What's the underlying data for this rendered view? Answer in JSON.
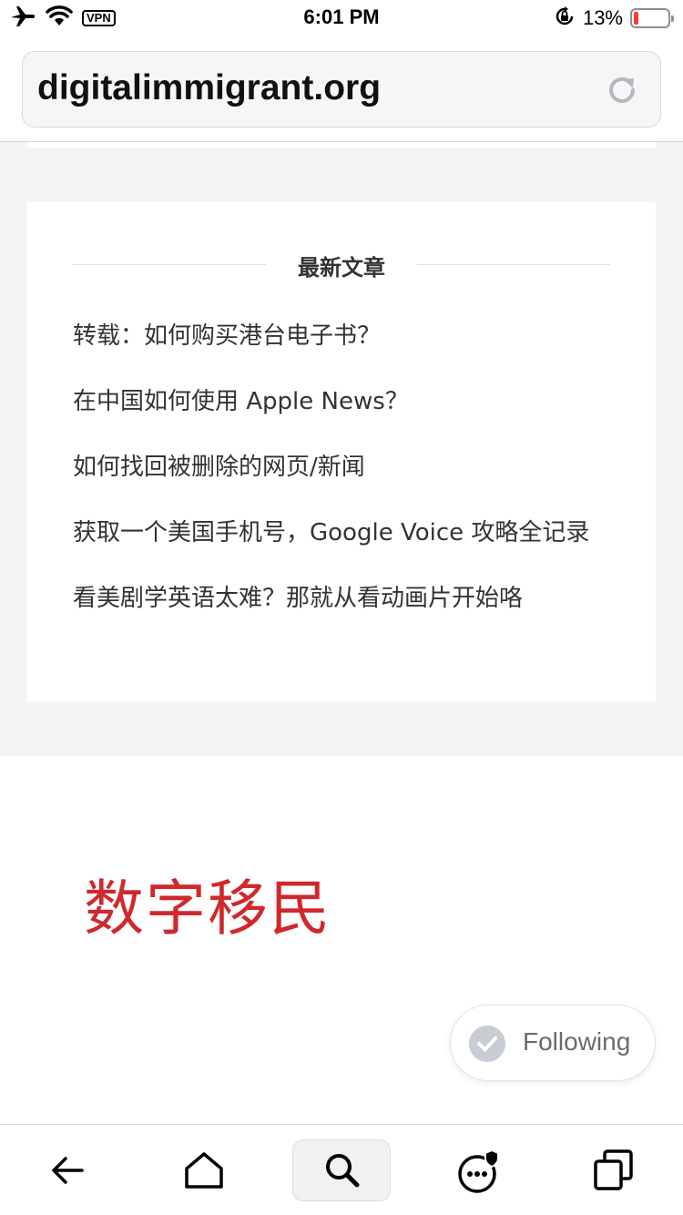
{
  "status_bar": {
    "vpn_label": "VPN",
    "time": "6:01 PM",
    "battery_text": "13%",
    "battery_level": 0.13,
    "icons": [
      "airplane-icon",
      "wifi-icon",
      "orientation-lock-icon",
      "battery-icon"
    ]
  },
  "browser": {
    "url": "digitalimmigrant.org",
    "reload_icon": "reload-icon"
  },
  "widget": {
    "title": "最新文章",
    "posts": [
      "转载：如何购买港台电子书？",
      "在中国如何使用 Apple News？",
      "如何找回被删除的网页/新闻",
      "获取一个美国手机号，Google Voice 攻略全记录",
      "看美剧学英语太难？那就从看动画片开始咯"
    ]
  },
  "site": {
    "brand": "数字移民",
    "brand_color": "#d0282c"
  },
  "follow": {
    "label": "Following"
  },
  "toolbar": {
    "buttons": [
      "back-icon",
      "home-icon",
      "search-icon",
      "menu-icon",
      "tabs-icon"
    ],
    "active": "search-icon"
  }
}
